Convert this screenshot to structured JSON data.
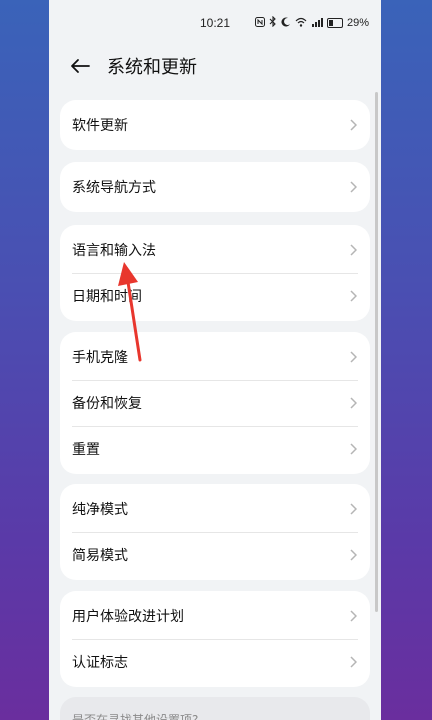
{
  "status_bar": {
    "time": "10:21",
    "icons": [
      "nfc-icon",
      "bluetooth-icon",
      "moon-icon",
      "wifi-icon",
      "signal-icon",
      "battery-icon"
    ],
    "battery": "29%"
  },
  "header": {
    "title": "系统和更新"
  },
  "groups": [
    {
      "items": [
        {
          "label": "软件更新"
        }
      ]
    },
    {
      "items": [
        {
          "label": "系统导航方式"
        }
      ]
    },
    {
      "items": [
        {
          "label": "语言和输入法"
        },
        {
          "label": "日期和时间"
        }
      ]
    },
    {
      "items": [
        {
          "label": "手机克隆"
        },
        {
          "label": "备份和恢复"
        },
        {
          "label": "重置"
        }
      ]
    },
    {
      "items": [
        {
          "label": "纯净模式"
        },
        {
          "label": "简易模式"
        }
      ]
    },
    {
      "items": [
        {
          "label": "用户体验改进计划"
        },
        {
          "label": "认证标志"
        }
      ]
    }
  ],
  "hint": {
    "text": "是否在寻找其他设置项?"
  },
  "colors": {
    "annotation_arrow": "#e8362d",
    "background_top": "#3a63b9",
    "background_bottom": "#6a2e9e"
  }
}
